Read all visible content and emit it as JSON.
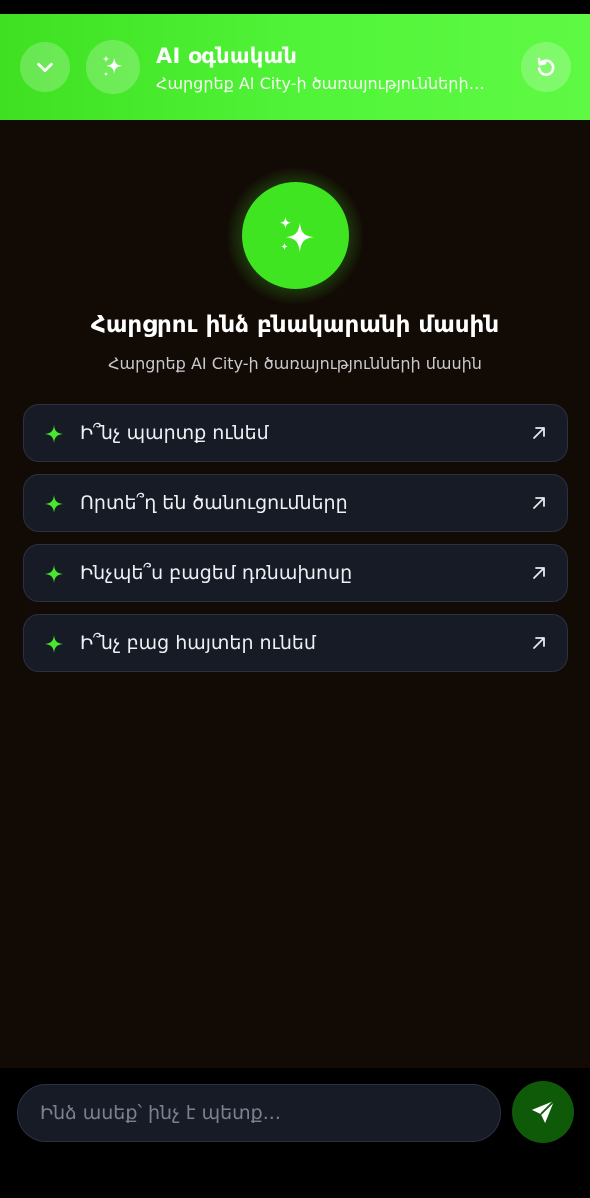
{
  "header": {
    "title": "AI օգնական",
    "subtitle": "Հարցրեք AI City-ի ծառայությունների մասին",
    "collapse_icon": "chevron-down-icon",
    "assistant_icon": "sparkles-icon",
    "reset_icon": "refresh-icon"
  },
  "hero": {
    "icon": "sparkles-icon",
    "title": "Հարցրու ինձ բնակարանի մասին",
    "subtitle": "Հարցրեք AI City-ի ծառայությունների մասին"
  },
  "suggestions": [
    {
      "label": "Ի՞նչ պարտք ունեմ",
      "icon": "sparkle-icon",
      "action_icon": "arrow-up-right-icon"
    },
    {
      "label": "Որտե՞ղ են ծանուցումները",
      "icon": "sparkle-icon",
      "action_icon": "arrow-up-right-icon"
    },
    {
      "label": "Ինչպե՞ս բացեմ դռնախոսը",
      "icon": "sparkle-icon",
      "action_icon": "arrow-up-right-icon"
    },
    {
      "label": "Ի՞նչ բաց հայտեր ունեմ",
      "icon": "sparkle-icon",
      "action_icon": "arrow-up-right-icon"
    }
  ],
  "composer": {
    "placeholder": "Ինձ ասեք՝ ինչ է պետք...",
    "send_icon": "send-icon"
  },
  "colors": {
    "accent": "#3ee520",
    "background": "#120b05",
    "card": "#161b26",
    "send_button": "#0f5a09"
  }
}
